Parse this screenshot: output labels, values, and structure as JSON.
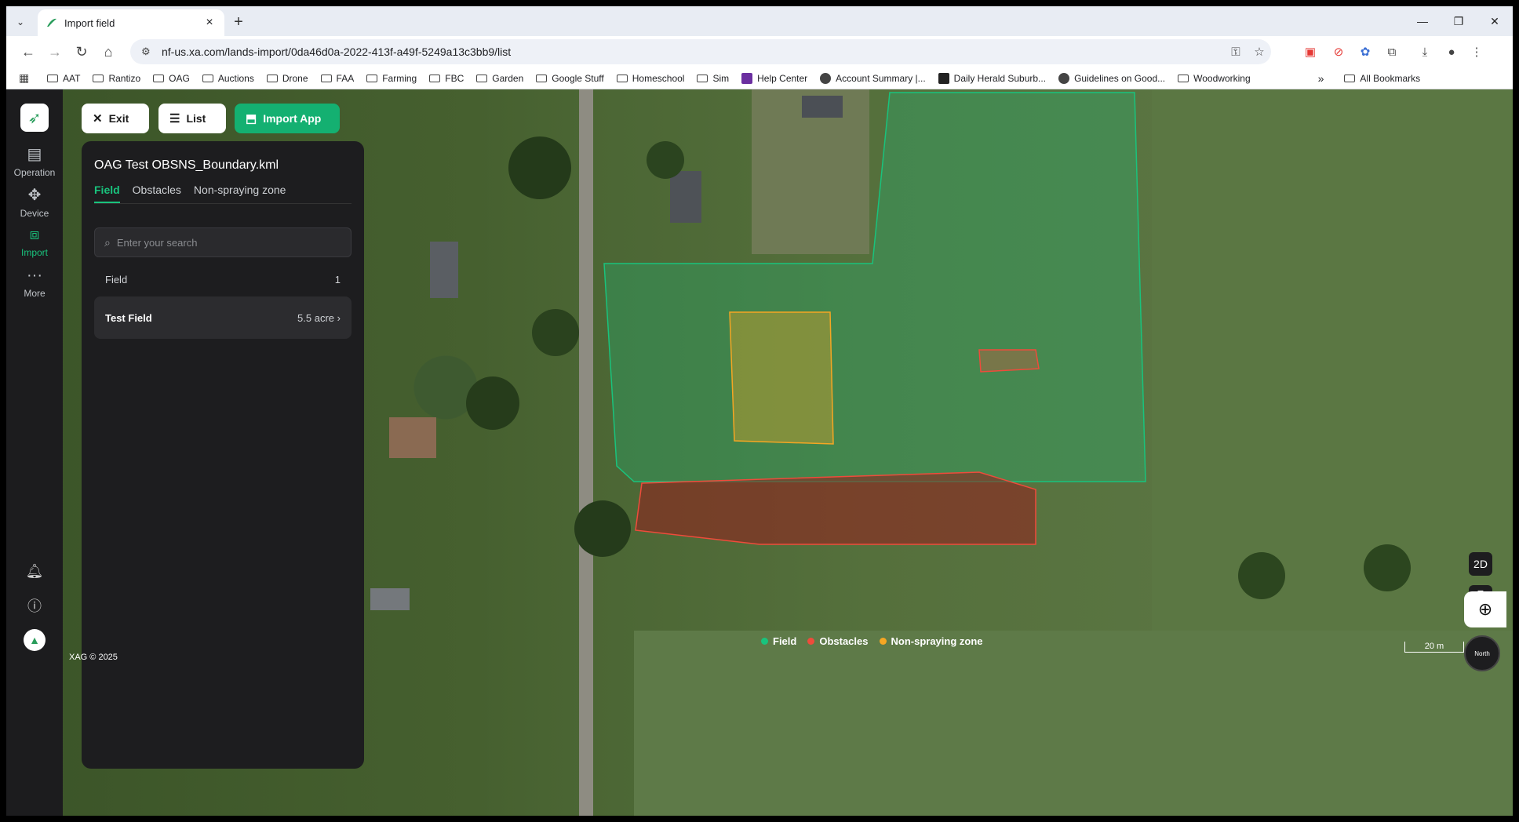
{
  "browser": {
    "tab_title": "Import field",
    "url": "nf-us.xa.com/lands-import/0da46d0a-2022-413f-a49f-5249a13c3bb9/list",
    "bookmarks": [
      "AAT",
      "Rantizo",
      "OAG",
      "Auctions",
      "Drone",
      "FAA",
      "Farming",
      "FBC",
      "Garden",
      "Google Stuff",
      "Homeschool",
      "Sim",
      "Help Center",
      "Account Summary |...",
      "Daily Herald Suburb...",
      "Guidelines on Good...",
      "Woodworking"
    ],
    "all_bookmarks": "All Bookmarks",
    "extension_badge": "4"
  },
  "rail": {
    "items": [
      {
        "label": "Operation",
        "icon": "operation-icon"
      },
      {
        "label": "Device",
        "icon": "drone-icon"
      },
      {
        "label": "Import",
        "icon": "import-icon"
      },
      {
        "label": "More",
        "icon": "more-icon"
      }
    ],
    "active": "Import"
  },
  "toolbar": {
    "exit_label": "Exit",
    "list_label": "List",
    "import_label": "Import App"
  },
  "panel": {
    "title": "OAG Test OBSNS_Boundary.kml",
    "tabs": [
      "Field",
      "Obstacles",
      "Non-spraying zone"
    ],
    "active_tab": "Field",
    "search_placeholder": "Enter your search",
    "section_label": "Field",
    "section_count": "1",
    "items": [
      {
        "name": "Test Field",
        "area": "5.5 acre"
      }
    ]
  },
  "map": {
    "legend": [
      {
        "label": "Field",
        "color": "#19c37d"
      },
      {
        "label": "Obstacles",
        "color": "#ef4b3b"
      },
      {
        "label": "Non-spraying zone",
        "color": "#f5a623"
      }
    ],
    "copyright": "XAG © 2025",
    "scale_label": "20 m",
    "view_mode": "2D",
    "compass_label": "North"
  }
}
